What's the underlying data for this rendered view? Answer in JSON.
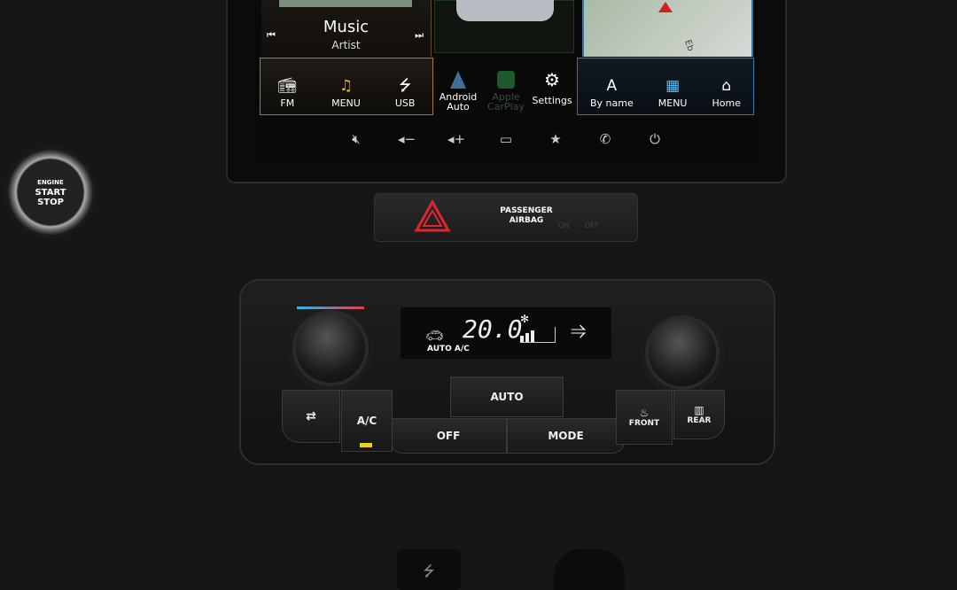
{
  "infotainment": {
    "music": {
      "title": "Music",
      "subtitle": "Artist",
      "prev_icon": "skip-previous-icon",
      "next_icon": "skip-next-icon"
    },
    "media_row": [
      {
        "label": "FM",
        "icon": "radio-icon"
      },
      {
        "label": "MENU",
        "icon": "music-note-icon"
      },
      {
        "label": "USB",
        "icon": "usb-icon"
      }
    ],
    "apps": [
      {
        "label": "Android Auto",
        "line1": "Android",
        "line2": "Auto",
        "icon": "android-auto-icon"
      },
      {
        "label": "Apple CarPlay",
        "line1": "Apple",
        "line2": "CarPlay",
        "icon": "carplay-icon",
        "disabled": true
      },
      {
        "label": "Settings",
        "line1": "Settings",
        "line2": "",
        "icon": "gear-icon"
      }
    ],
    "nav_row": [
      {
        "label": "By name",
        "icon": "letter-a-icon"
      },
      {
        "label": "MENU",
        "icon": "grid-icon"
      },
      {
        "label": "Home",
        "icon": "home-icon"
      }
    ],
    "map_street_label": "Eb",
    "system_buttons": [
      "mute-icon",
      "volume-down-icon",
      "volume-up-icon",
      "screen-icon",
      "star-icon",
      "phone-icon",
      "power-icon"
    ],
    "accent_media": "#b07a1c",
    "accent_nav": "#1f7fb8"
  },
  "engine_button": {
    "line1": "ENGINE",
    "line2": "START",
    "line3": "STOP"
  },
  "hazard": {
    "icon": "hazard-triangle-icon",
    "color": "#e0262b"
  },
  "airbag": {
    "line1": "PASSENGER",
    "line2": "AIRBAG",
    "on": "ON",
    "off": "OFF"
  },
  "climate": {
    "temperature": "20.0",
    "mode_text": "AUTO A/C",
    "fan_level": 3,
    "buttons": {
      "auto": "AUTO",
      "off": "OFF",
      "mode": "MODE",
      "ac": "A/C",
      "front": "FRONT",
      "rear": "REAR"
    }
  }
}
